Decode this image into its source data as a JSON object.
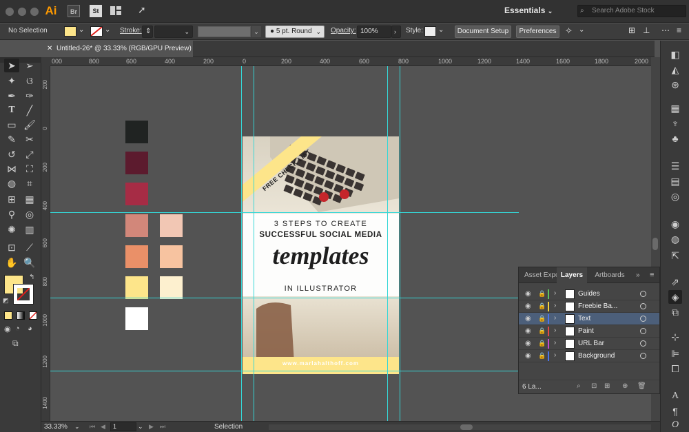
{
  "app": {
    "name": "Ai",
    "bridge": "Br",
    "stock": "St"
  },
  "workspace": {
    "label": "Essentials",
    "search_placeholder": "Search Adobe Stock"
  },
  "control": {
    "selection": "No Selection",
    "fill_color": "#fde58a",
    "stroke_label": "Stroke:",
    "brush": "5 pt. Round",
    "opacity_label": "Opacity:",
    "opacity_value": "100%",
    "style_label": "Style:",
    "document_setup": "Document Setup",
    "preferences": "Preferences"
  },
  "document": {
    "tab_title": "Untitled-26* @ 33.33% (RGB/GPU Preview)"
  },
  "rulers": {
    "top": [
      "000",
      "800",
      "600",
      "400",
      "200",
      "0",
      "200",
      "400",
      "600",
      "800",
      "1000",
      "1200",
      "1400",
      "1600",
      "1800",
      "2000"
    ],
    "left": [
      "200",
      "0",
      "200",
      "400",
      "600",
      "800",
      "1000",
      "1200",
      "1400"
    ]
  },
  "swatches": [
    {
      "color": "#202322"
    },
    {
      "color": "#5c1b2e"
    },
    {
      "color": "#a62c45"
    },
    {
      "color": "#d2877a"
    },
    {
      "color": "#f2c7b4"
    },
    {
      "color": "#ea9068"
    },
    {
      "color": "#f7c3a0"
    },
    {
      "color": "#fde58a"
    },
    {
      "color": "#fdf0cf"
    },
    {
      "color": "#ffffff"
    }
  ],
  "artwork": {
    "ribbon": "FREE CHECK LIST",
    "line1": "3 STEPS TO CREATE",
    "line2": "SUCCESSFUL SOCIAL MEDIA",
    "script": "templates",
    "line3": "IN ILLUSTRATOR",
    "url": "www.marlahalthoff.com",
    "accent": "#fde58a"
  },
  "layers_panel": {
    "tabs": [
      "Asset Expo",
      "Layers",
      "Artboards"
    ],
    "layers": [
      {
        "name": "Guides",
        "color": "#5ec55e"
      },
      {
        "name": "Freebie Ba...",
        "color": "#f2d33d"
      },
      {
        "name": "Text",
        "color": "#4a74e8"
      },
      {
        "name": "Paint",
        "color": "#e14848"
      },
      {
        "name": "URL Bar",
        "color": "#c44ad0"
      },
      {
        "name": "Background",
        "color": "#4a74e8"
      }
    ],
    "footer_count": "6 La..."
  },
  "status": {
    "zoom": "33.33%",
    "artboard": "1",
    "tool": "Selection"
  }
}
